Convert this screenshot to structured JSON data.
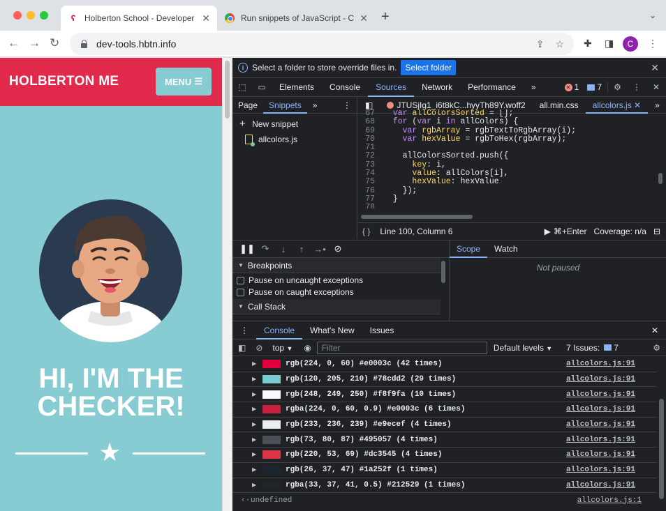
{
  "browser": {
    "tabs": [
      {
        "title": "Holberton School - Developer",
        "active": true
      },
      {
        "title": "Run snippets of JavaScript - C",
        "active": false
      }
    ],
    "url": "dev-tools.hbtn.info",
    "profile_initial": "C"
  },
  "site": {
    "brand": "HOLBERTON ME",
    "menu_label": "MENU",
    "hero_line1": "HI, I'M THE",
    "hero_line2": "CHECKER!",
    "colors": {
      "header": "#e0294b",
      "background": "#87ccd2",
      "avatar_bg": "#2a3b50"
    }
  },
  "devtools": {
    "infobar": {
      "text": "Select a folder to store override files in.",
      "button": "Select folder"
    },
    "main_tabs": [
      "Elements",
      "Console",
      "Sources",
      "Network",
      "Performance"
    ],
    "active_main_tab": "Sources",
    "error_count": "1",
    "message_count": "7",
    "nav_tabs": [
      "Page",
      "Snippets"
    ],
    "new_snippet": "New snippet",
    "snippet_file": "allcolors.js",
    "editor_tabs": [
      "JTUSjIg1_i6t8kC...hyyTh89Y.woff2",
      "all.min.css",
      "allcolors.js"
    ],
    "code_lines": [
      {
        "n": "67",
        "text": "  var allColorsSorted = [];"
      },
      {
        "n": "68",
        "text": "  for (var i in allColors) {"
      },
      {
        "n": "69",
        "text": "    var rgbArray = rgbTextToRgbArray(i);"
      },
      {
        "n": "70",
        "text": "    var hexValue = rgbToHex(rgbArray);"
      },
      {
        "n": "71",
        "text": ""
      },
      {
        "n": "72",
        "text": "    allColorsSorted.push({"
      },
      {
        "n": "73",
        "text": "      key: i,"
      },
      {
        "n": "74",
        "text": "      value: allColors[i],"
      },
      {
        "n": "75",
        "text": "      hexValue: hexValue"
      },
      {
        "n": "76",
        "text": "    });"
      },
      {
        "n": "77",
        "text": "  }"
      },
      {
        "n": "78",
        "text": ""
      }
    ],
    "status": {
      "position": "Line 100, Column 6",
      "run": "⌘+Enter",
      "coverage": "Coverage: n/a"
    },
    "breakpoints": {
      "title": "Breakpoints",
      "uncaught": "Pause on uncaught exceptions",
      "caught": "Pause on caught exceptions",
      "call_stack": "Call Stack"
    },
    "scope_tabs": [
      "Scope",
      "Watch"
    ],
    "not_paused": "Not paused",
    "drawer_tabs": [
      "Console",
      "What's New",
      "Issues"
    ],
    "console_toolbar": {
      "context": "top",
      "filter_placeholder": "Filter",
      "levels": "Default levels",
      "issues_label": "7 Issues:",
      "issues_count": "7"
    },
    "logs": [
      {
        "color": "#e0003c",
        "text": "rgb(224, 0, 60) #e0003c (42 times)",
        "src": "allcolors.js:91"
      },
      {
        "color": "#78cdd2",
        "text": "rgb(120, 205, 210) #78cdd2 (29 times)",
        "src": "allcolors.js:91"
      },
      {
        "color": "#f8f9fa",
        "text": "rgb(248, 249, 250) #f8f9fa (10 times)",
        "src": "allcolors.js:91"
      },
      {
        "color": "#c8203f",
        "text": "rgba(224, 0, 60, 0.9) #e0003c (6 times)",
        "src": "allcolors.js:91"
      },
      {
        "color": "#e9ecef",
        "text": "rgb(233, 236, 239) #e9ecef (4 times)",
        "src": "allcolors.js:91"
      },
      {
        "color": "#495057",
        "text": "rgb(73, 80, 87) #495057 (4 times)",
        "src": "allcolors.js:91"
      },
      {
        "color": "#dc3545",
        "text": "rgb(220, 53, 69) #dc3545 (4 times)",
        "src": "allcolors.js:91"
      },
      {
        "color": "#1a252f",
        "text": "rgb(26, 37, 47) #1a252f (1 times)",
        "src": "allcolors.js:91"
      },
      {
        "color": "#212529",
        "text": "rgba(33, 37, 41, 0.5) #212529 (1 times)",
        "src": "allcolors.js:91"
      }
    ],
    "result": {
      "text": "undefined",
      "src": "allcolors.js:1"
    }
  }
}
